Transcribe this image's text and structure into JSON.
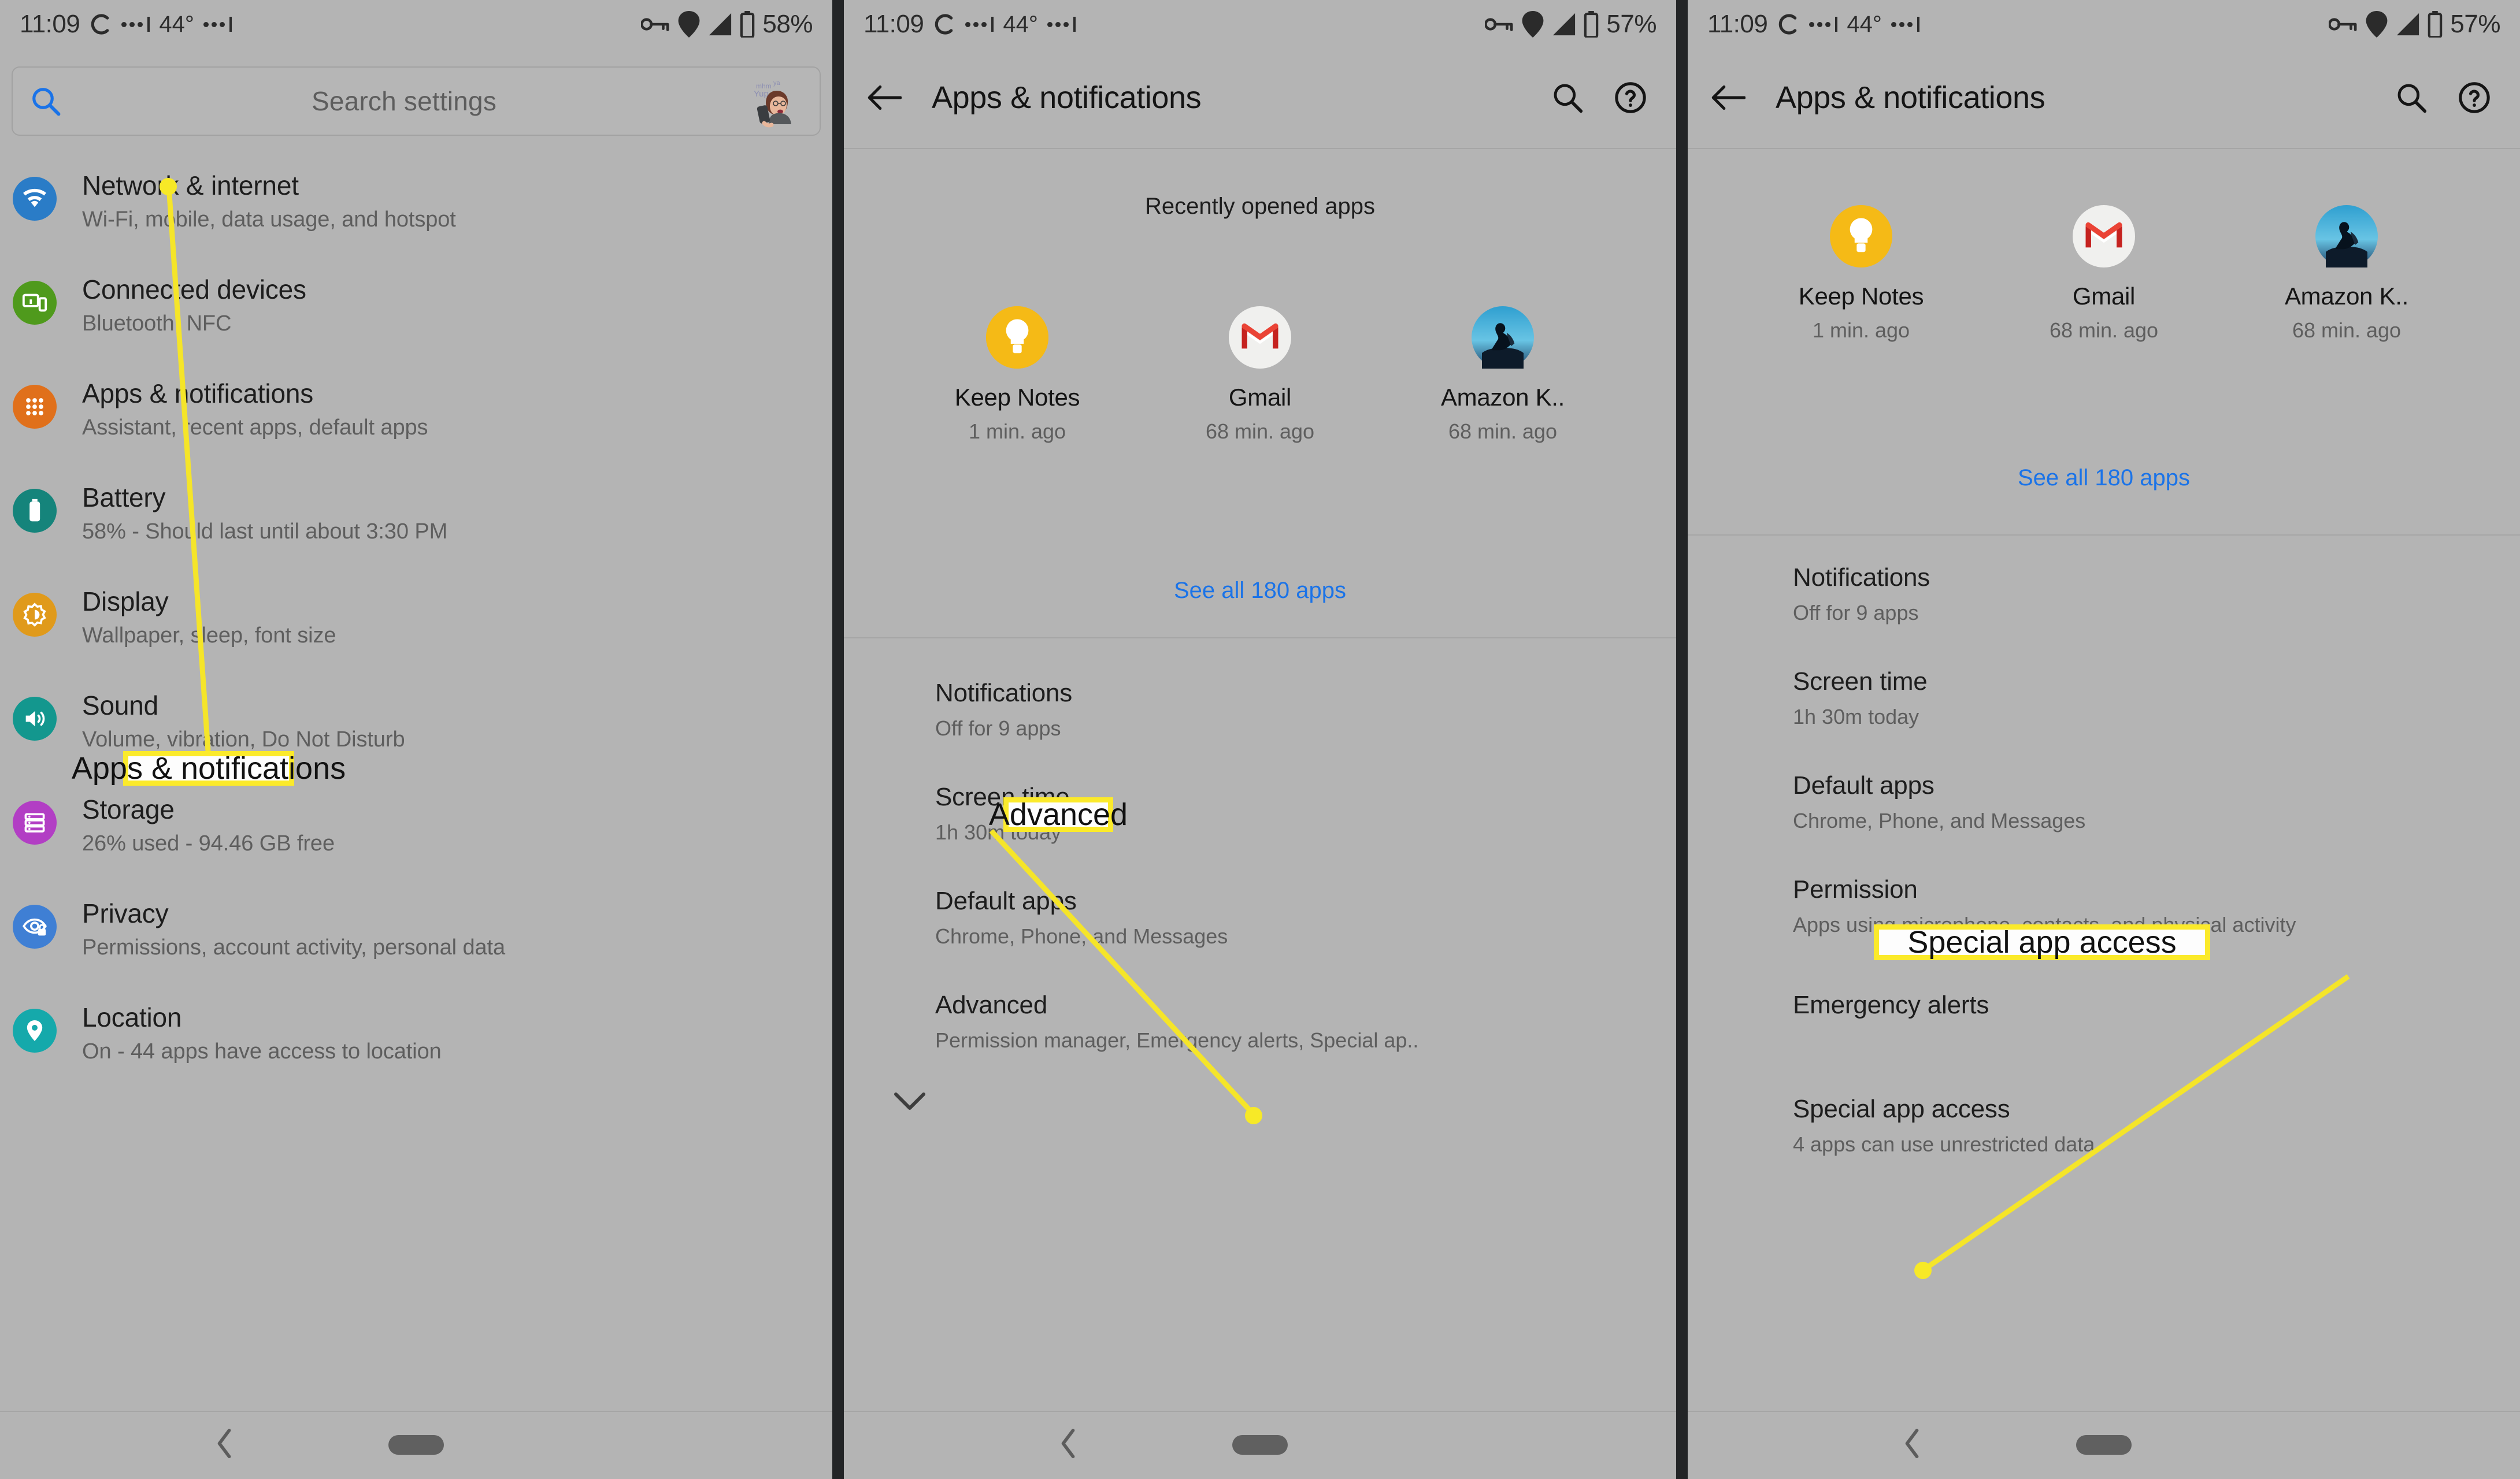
{
  "panels": [
    {
      "id": "settings-home",
      "status_bar": {
        "time": "11:09",
        "temperature": "44°",
        "battery": "58%",
        "icons": [
          "sync-icon",
          "signal-dots-icon",
          "weather-dots-icon",
          "vpn-key-icon",
          "location-icon",
          "signal-bars-icon",
          "battery-icon"
        ]
      },
      "search": {
        "placeholder": "Search settings",
        "icon": "search-icon",
        "avatar": "user-avatar-bitmoji"
      },
      "items": [
        {
          "title": "Network & internet",
          "subtitle": "Wi-Fi, mobile, data usage, and hotspot",
          "icon": "wifi-icon",
          "color": "#2a7cc7"
        },
        {
          "title": "Connected devices",
          "subtitle": "Bluetooth, NFC",
          "icon": "devices-icon",
          "color": "#4f9a1c"
        },
        {
          "title": "Apps & notifications",
          "subtitle": "Assistant, recent apps, default apps",
          "icon": "apps-grid-icon",
          "color": "#e0701b"
        },
        {
          "title": "Battery",
          "subtitle": "58% - Should last until about 3:30 PM",
          "icon": "battery-icon",
          "color": "#15847b"
        },
        {
          "title": "Display",
          "subtitle": "Wallpaper, sleep, font size",
          "icon": "brightness-icon",
          "color": "#e09a1b"
        },
        {
          "title": "Sound",
          "subtitle": "Volume, vibration, Do Not Disturb",
          "icon": "volume-icon",
          "color": "#13978e"
        },
        {
          "title": "Storage",
          "subtitle": "26% used - 94.46 GB free",
          "icon": "storage-icon",
          "color": "#b23ec4"
        },
        {
          "title": "Privacy",
          "subtitle": "Permissions, account activity, personal data",
          "icon": "privacy-eye-icon",
          "color": "#3f7fd4"
        },
        {
          "title": "Location",
          "subtitle": "On - 44 apps have access to location",
          "icon": "location-pin-icon",
          "color": "#15a9ab"
        }
      ],
      "callout": {
        "text": "Apps & notifications"
      },
      "nav": {
        "back": "nav-back-icon",
        "home": "nav-home-pill"
      }
    },
    {
      "id": "apps-notifications",
      "status_bar": {
        "time": "11:09",
        "temperature": "44°",
        "battery": "57%"
      },
      "appbar": {
        "back": "back-arrow-icon",
        "title": "Apps & notifications",
        "search": "search-icon",
        "help": "help-circle-icon"
      },
      "recent_header": "Recently opened apps",
      "recent_apps": [
        {
          "name": "Keep Notes",
          "time": "1 min. ago",
          "icon": "keep-notes-icon"
        },
        {
          "name": "Gmail",
          "time": "68 min. ago",
          "icon": "gmail-icon"
        },
        {
          "name": "Amazon K..",
          "time": "68 min. ago",
          "icon": "kindle-icon"
        }
      ],
      "see_all": "See all 180 apps",
      "options": [
        {
          "title": "Notifications",
          "subtitle": "Off for 9 apps"
        },
        {
          "title": "Screen time",
          "subtitle": "1h 30m today"
        },
        {
          "title": "Default apps",
          "subtitle": "Chrome, Phone, and Messages"
        },
        {
          "title": "Advanced",
          "subtitle": "Permission manager, Emergency alerts, Special ap..",
          "expandable": true
        }
      ],
      "callout": {
        "text": "Advanced"
      },
      "nav": {
        "back": "nav-back-icon",
        "home": "nav-home-pill"
      }
    },
    {
      "id": "apps-notifications-expanded",
      "status_bar": {
        "time": "11:09",
        "temperature": "44°",
        "battery": "57%"
      },
      "appbar": {
        "back": "back-arrow-icon",
        "title": "Apps & notifications",
        "search": "search-icon",
        "help": "help-circle-icon"
      },
      "recent_apps": [
        {
          "name": "Keep Notes",
          "time": "1 min. ago",
          "icon": "keep-notes-icon"
        },
        {
          "name": "Gmail",
          "time": "68 min. ago",
          "icon": "gmail-icon"
        },
        {
          "name": "Amazon K..",
          "time": "68 min. ago",
          "icon": "kindle-icon"
        }
      ],
      "see_all": "See all 180 apps",
      "options": [
        {
          "title": "Notifications",
          "subtitle": "Off for 9 apps"
        },
        {
          "title": "Screen time",
          "subtitle": "1h 30m today"
        },
        {
          "title": "Default apps",
          "subtitle": "Chrome, Phone, and Messages"
        },
        {
          "title": "Permission",
          "subtitle": "Apps using microphone, contacts, and physical activity"
        },
        {
          "title": "Emergency alerts",
          "subtitle": ""
        },
        {
          "title": "Special app access",
          "subtitle": "4 apps can use unrestricted data"
        }
      ],
      "callout": {
        "text": "Special app access"
      },
      "nav": {
        "back": "nav-back-icon",
        "home": "nav-home-pill"
      }
    }
  ],
  "theme": {
    "screen_bg": "#b4b4b4",
    "divider": "#222426",
    "link": "#1a73e8",
    "callout_border": "#fbea2b",
    "callout_bg": "#fdfdfd",
    "leader_line": "#f5e529"
  }
}
